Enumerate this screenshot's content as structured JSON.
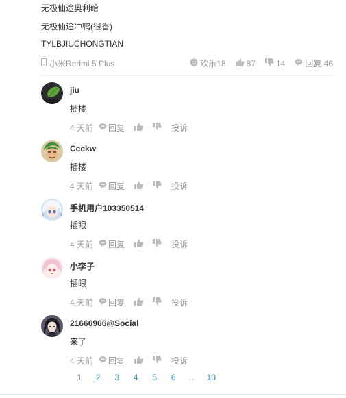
{
  "post": {
    "lines": [
      "无极仙途奥利给",
      "无极仙途冲鸭(很香)",
      "TYLBJIUCHONGTIAN"
    ],
    "device": "小米Redmi 5 Plus",
    "stats": {
      "fun": "欢乐18",
      "likes": "87",
      "dislikes": "14",
      "replies": "回复 46"
    }
  },
  "comments": [
    {
      "user": "jiu",
      "text": "插楼",
      "time": "4 天前",
      "reply": "回复",
      "report": "投诉",
      "avatar_icon": "green-leaf-avatar"
    },
    {
      "user": "Ccckw",
      "text": "插楼",
      "time": "4 天前",
      "reply": "回复",
      "report": "投诉",
      "avatar_icon": "green-hair-character-avatar"
    },
    {
      "user": "手机用户103350514",
      "text": "插眼",
      "time": "4 天前",
      "reply": "回复",
      "report": "投诉",
      "avatar_icon": "anime-white-hair-avatar"
    },
    {
      "user": "小李子",
      "text": "插眼",
      "time": "4 天前",
      "reply": "回复",
      "report": "投诉",
      "avatar_icon": "anime-pink-hair-avatar"
    },
    {
      "user": "21666966@Social",
      "text": "来了",
      "time": "4 天前",
      "reply": "回复",
      "report": "投诉",
      "avatar_icon": "dark-hair-character-avatar"
    }
  ],
  "pagination": {
    "pages": [
      "1",
      "2",
      "3",
      "4",
      "5",
      "6",
      "...",
      "10"
    ],
    "current": "1"
  },
  "colors": {
    "text": "#333333",
    "muted": "#999999",
    "link": "#3a8fb7",
    "divider": "#eeeeee"
  }
}
